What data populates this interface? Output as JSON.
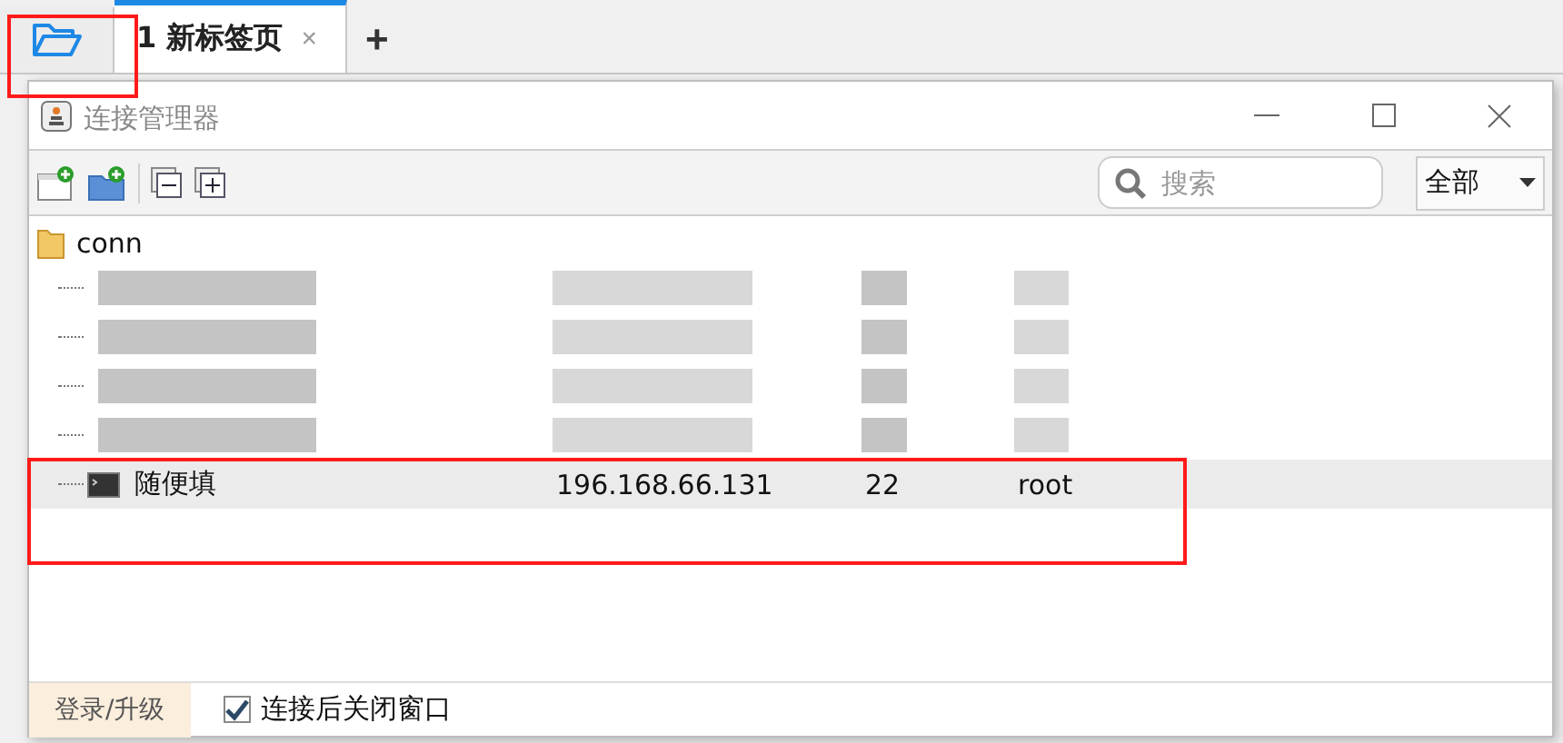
{
  "app_tabs": {
    "open_button": {
      "highlighted": true
    },
    "tabs": [
      {
        "label": "1 新标签页",
        "close": "×",
        "selected": true
      }
    ],
    "add": "+"
  },
  "dialog": {
    "title": "连接管理器",
    "toolbar": {
      "search": {
        "placeholder": "搜索"
      },
      "filter": {
        "value": "全部"
      }
    },
    "tree": {
      "label": "conn",
      "children": [
        {
          "kind": "redacted"
        },
        {
          "kind": "redacted"
        },
        {
          "kind": "redacted"
        },
        {
          "kind": "redacted"
        },
        {
          "kind": "session",
          "name": "随便填",
          "host": "196.168.66.131",
          "port": "22",
          "user": "root",
          "selected": true,
          "highlighted": true
        }
      ]
    },
    "footer": {
      "login": "登录/升级",
      "close_after_connect": {
        "label": "连接后关闭窗口",
        "checked": true
      }
    }
  }
}
